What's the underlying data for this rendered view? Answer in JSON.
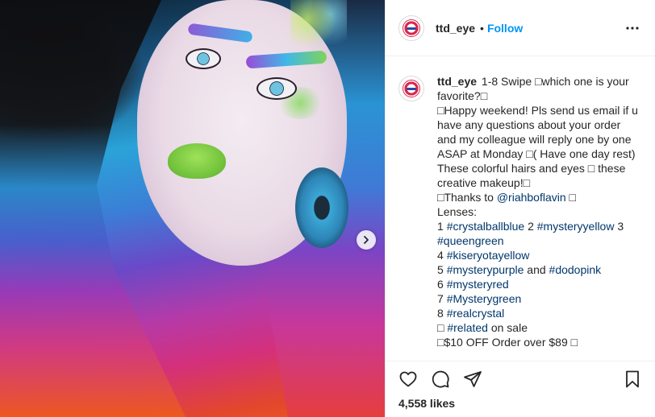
{
  "post": {
    "username": "ttd_eye",
    "follow_label": "Follow",
    "separator": "•",
    "caption": {
      "username": "ttd_eye",
      "l1": "1-8 Swipe □which one is your favorite?□",
      "l2": "□Happy weekend! Pls send us email if u have any questions about your order and my colleague will reply one by one ASAP at Monday □( Have one day rest)",
      "l3": "These colorful hairs and eyes □ these creative makeup!□",
      "l4_pre": "□Thanks to ",
      "l4_tag": "@riahboflavin",
      "l4_post": " □",
      "lenses_label": "Lenses:",
      "n1": "1 ",
      "t1": "#crystalballblue",
      "n2": " 2 ",
      "t2": "#mysteryyellow",
      "n3": " 3 ",
      "t3": "#queengreen",
      "n4": "4 ",
      "t4": "#kiseryotayellow",
      "n5": "5 ",
      "t5": "#mysterypurple",
      "and": " and ",
      "t5b": "#dodopink",
      "n6": "6 ",
      "t6": "#mysteryred",
      "n7": "7 ",
      "t7": "#Mysterygreen",
      "n8": "8 ",
      "t8": "#realcrystal",
      "rel_pre": "□ ",
      "rel_tag": "#related",
      "rel_post": " on sale",
      "offer": "□$10 OFF Order over $89 □"
    },
    "likes": "4,558 likes"
  },
  "icons": {
    "like": "heart-icon",
    "comment": "comment-icon",
    "share": "paper-plane-icon",
    "save": "bookmark-icon",
    "more": "more-options-icon",
    "next": "chevron-right-icon"
  },
  "colors": {
    "link": "#0095f6",
    "hashtag": "#00376b",
    "text": "#262626",
    "border": "#efefef"
  }
}
